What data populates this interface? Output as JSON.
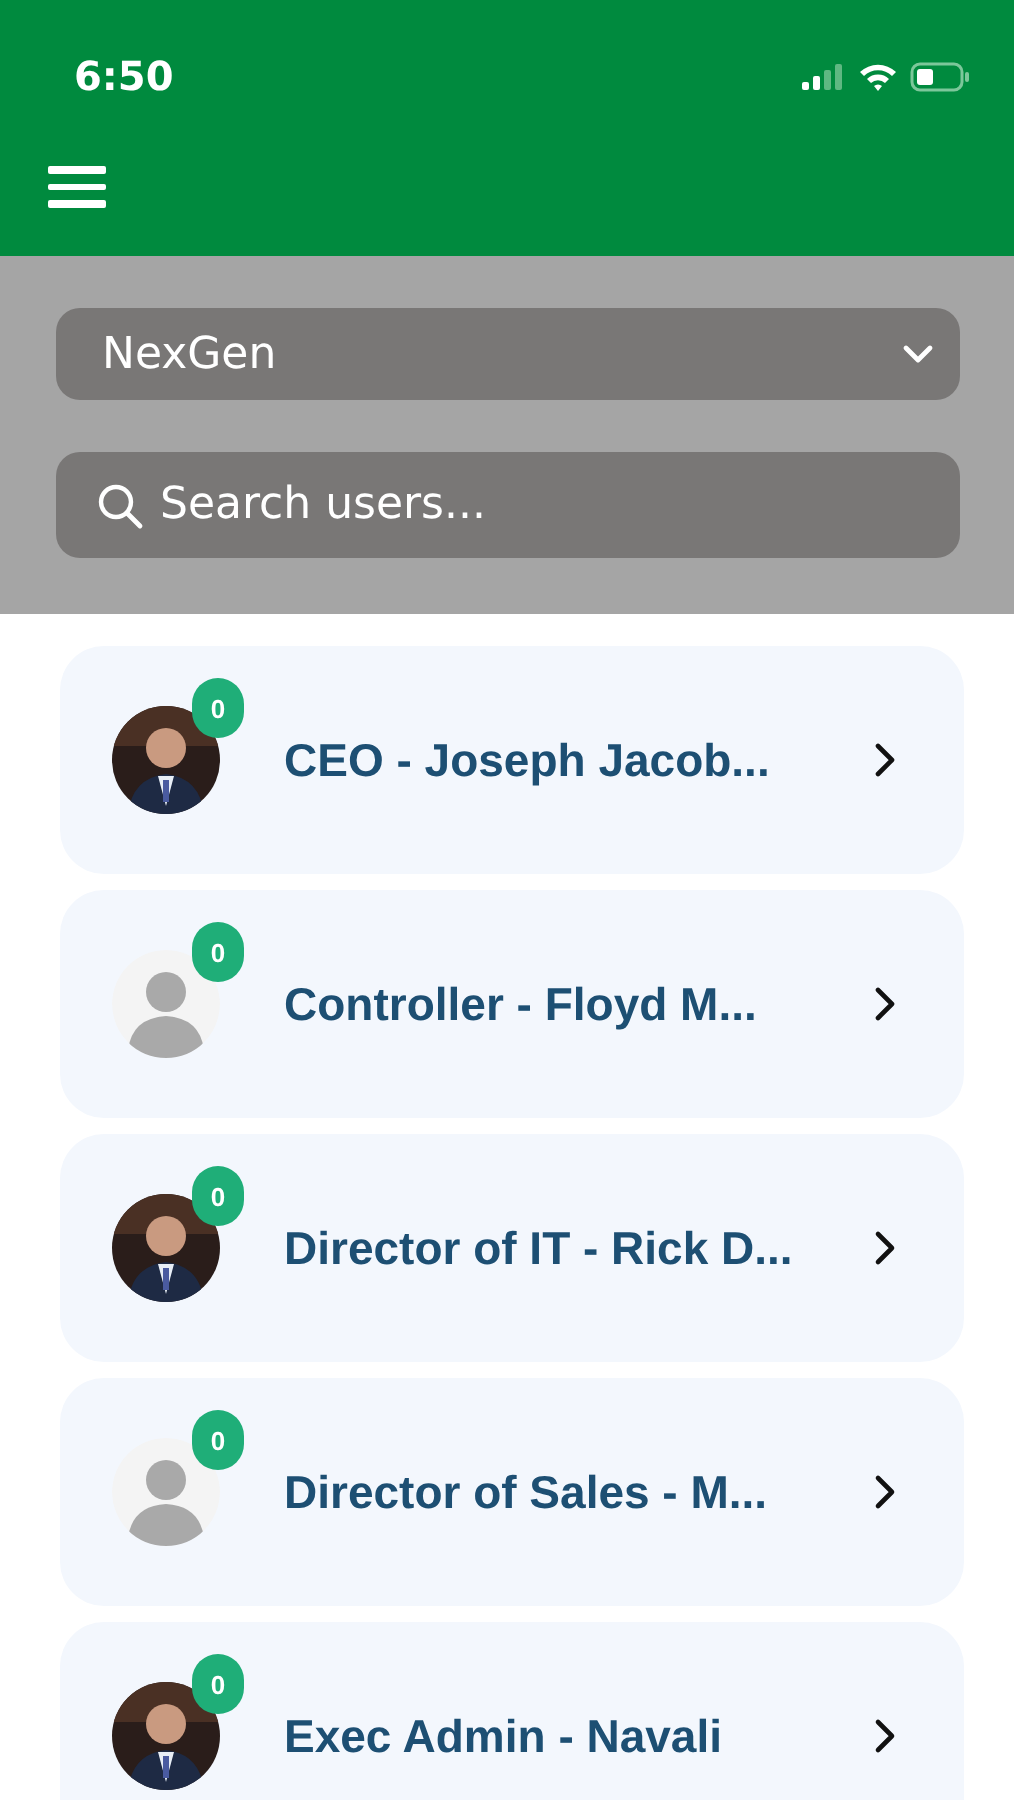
{
  "status_bar": {
    "time": "6:50"
  },
  "company_select": {
    "value": "NexGen"
  },
  "search": {
    "placeholder": "Search users..."
  },
  "users": [
    {
      "name": "CEO - Joseph Jacob...",
      "badge": "0"
    },
    {
      "name": "Controller - Floyd M...",
      "badge": "0",
      "kind": "placeholder"
    },
    {
      "name": "Director of IT - Rick D...",
      "badge": "0"
    },
    {
      "name": "Director of Sales - M...",
      "badge": "0",
      "kind": "placeholder"
    },
    {
      "name": "Exec Admin - Navali",
      "badge": "0"
    }
  ]
}
